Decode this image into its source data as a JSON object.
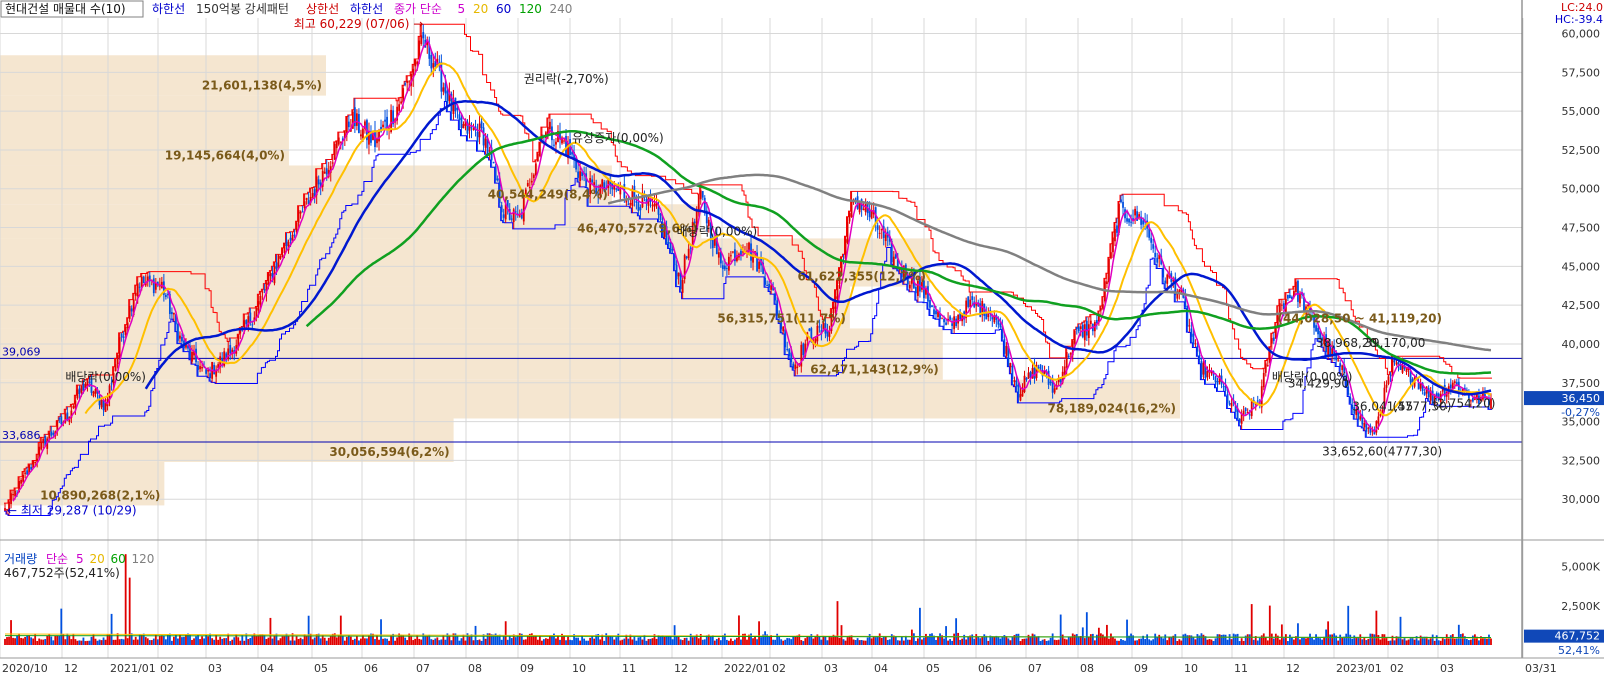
{
  "header": {
    "title_box": "현대건설 매물대 수(10)",
    "items": [
      {
        "text": "하한선",
        "color": "#0000cc"
      },
      {
        "text": "150억봉 강세패턴",
        "color": "#333333"
      },
      {
        "text": "상한선",
        "color": "#cc0000"
      },
      {
        "text": "하한선",
        "color": "#0000cc"
      },
      {
        "text": "종가 단순",
        "color": "#cc00cc"
      },
      {
        "text": "5",
        "color": "#cc00cc"
      },
      {
        "text": "20",
        "color": "#e6b800"
      },
      {
        "text": "60",
        "color": "#0000cc"
      },
      {
        "text": "120",
        "color": "#00a000"
      },
      {
        "text": "240",
        "color": "#808080"
      }
    ],
    "top_right_lc": "LC:24.0",
    "top_right_hc": "HC:-39.4"
  },
  "colors": {
    "up": "#e00000",
    "down": "#0050e0",
    "ma5": "#e000c0",
    "ma20": "#ffc000",
    "ma60": "#0018d0",
    "ma120": "#10a020",
    "ma240": "#808080",
    "band_upper": "#ff0000",
    "band_lower": "#0000ff",
    "volume_profile": "#f5e6d0",
    "hline": "#0000b0",
    "grid": "#d8d8d8"
  },
  "chart_data": [
    {
      "type": "candlestick",
      "title": "현대건설 매물대 수(10)",
      "ylim": [
        27500,
        61000
      ],
      "y_ticks": [
        "30,000",
        "32,500",
        "35,000",
        "37,500",
        "40,000",
        "42,500",
        "45,000",
        "47,500",
        "50,000",
        "52,500",
        "55,000",
        "57,500",
        "60,000"
      ],
      "x_ticks": [
        "2020/10",
        "12",
        "2021/01",
        "02",
        "03",
        "04",
        "05",
        "06",
        "07",
        "08",
        "09",
        "10",
        "11",
        "12",
        "2022/01",
        "02",
        "03",
        "04",
        "05",
        "06",
        "07",
        "08",
        "09",
        "10",
        "11",
        "12",
        "2023/01",
        "02",
        "03",
        "03/31"
      ],
      "close_anchors": [
        [
          0,
          29300
        ],
        [
          10,
          31500
        ],
        [
          20,
          33800
        ],
        [
          30,
          35200
        ],
        [
          40,
          37500
        ],
        [
          50,
          36000
        ],
        [
          58,
          40500
        ],
        [
          66,
          44000
        ],
        [
          78,
          43800
        ],
        [
          88,
          40000
        ],
        [
          100,
          38000
        ],
        [
          112,
          39500
        ],
        [
          124,
          42000
        ],
        [
          136,
          45500
        ],
        [
          148,
          48500
        ],
        [
          160,
          51500
        ],
        [
          172,
          54500
        ],
        [
          184,
          53000
        ],
        [
          196,
          55500
        ],
        [
          208,
          59500
        ],
        [
          214,
          58000
        ],
        [
          226,
          54000
        ],
        [
          238,
          53500
        ],
        [
          248,
          48500
        ],
        [
          256,
          48000
        ],
        [
          268,
          54000
        ],
        [
          278,
          53000
        ],
        [
          290,
          50000
        ],
        [
          302,
          50000
        ],
        [
          312,
          49500
        ],
        [
          324,
          48500
        ],
        [
          336,
          44000
        ],
        [
          346,
          49500
        ],
        [
          356,
          45000
        ],
        [
          368,
          46500
        ],
        [
          380,
          44000
        ],
        [
          392,
          38500
        ],
        [
          400,
          40500
        ],
        [
          410,
          41000
        ],
        [
          422,
          49500
        ],
        [
          432,
          48000
        ],
        [
          444,
          45000
        ],
        [
          456,
          43500
        ],
        [
          468,
          41000
        ],
        [
          480,
          42500
        ],
        [
          492,
          42000
        ],
        [
          504,
          37000
        ],
        [
          514,
          38500
        ],
        [
          522,
          37000
        ],
        [
          532,
          40500
        ],
        [
          544,
          41500
        ],
        [
          554,
          48500
        ],
        [
          566,
          48000
        ],
        [
          576,
          44500
        ],
        [
          584,
          43500
        ],
        [
          594,
          38500
        ],
        [
          604,
          37500
        ],
        [
          614,
          35000
        ],
        [
          624,
          36500
        ],
        [
          634,
          42500
        ],
        [
          642,
          43500
        ],
        [
          654,
          40500
        ],
        [
          664,
          38500
        ],
        [
          672,
          35500
        ],
        [
          680,
          34000
        ],
        [
          690,
          38500
        ],
        [
          700,
          38000
        ],
        [
          710,
          36500
        ],
        [
          720,
          37500
        ],
        [
          730,
          36500
        ],
        [
          738,
          36450
        ]
      ],
      "moving_averages": [
        {
          "name": "5",
          "period": 5
        },
        {
          "name": "20",
          "period": 20
        },
        {
          "name": "60",
          "period": 60
        },
        {
          "name": "120",
          "period": 120
        },
        {
          "name": "240",
          "period": 240
        }
      ],
      "volume_profile": [
        {
          "low": 56000,
          "high": 58600,
          "label": "21,601,138(4,5%)"
        },
        {
          "low": 51500,
          "high": 56000,
          "label": "19,145,664(4,0%)"
        },
        {
          "low": 49000,
          "high": 51500,
          "label": "40,544,249(8,4%)"
        },
        {
          "low": 46800,
          "high": 49000,
          "label": "46,470,572(9,6%)"
        },
        {
          "low": 43700,
          "high": 46800,
          "label": "61,622,355(12,7%)"
        },
        {
          "low": 41000,
          "high": 43700,
          "label": "56,315,751(11,7%)"
        },
        {
          "low": 37700,
          "high": 41000,
          "label": "62,471,143(12,9%)"
        },
        {
          "low": 35200,
          "high": 37700,
          "label": "78,189,024(16,2%)"
        },
        {
          "low": 32400,
          "high": 35200,
          "label": "30,056,594(6,2%)"
        },
        {
          "low": 29600,
          "high": 32400,
          "label": "10,890,268(2,1%)"
        }
      ],
      "profile_range_label": "(44,028,50 ~ 41,119,20)",
      "reference_lines": [
        {
          "value": 39069,
          "label": "39,069"
        },
        {
          "value": 33686,
          "label": "33,686"
        }
      ],
      "annotations": [
        {
          "text": "최고 60,229 (07/06)",
          "x": 210,
          "y": 60229
        },
        {
          "text": "최저 29,287 (10/29)",
          "x": 0,
          "y": 29287
        },
        {
          "text": "권리락(-2,70%)",
          "x": 258,
          "y": 56800
        },
        {
          "text": "유상증자(0,00%)",
          "x": 282,
          "y": 53000
        },
        {
          "text": "배당락(0,00%)",
          "x": 334,
          "y": 47000
        },
        {
          "text": "배당락(0,00%)",
          "x": 30,
          "y": 37600
        },
        {
          "text": "배당락(0,00%)",
          "x": 630,
          "y": 37600
        },
        {
          "text": "38,968,20",
          "x": 652,
          "y": 39800
        },
        {
          "text": "39,170,00",
          "x": 676,
          "y": 39800
        },
        {
          "text": "34,429,90",
          "x": 638,
          "y": 37200
        },
        {
          "text": "36,041,55",
          "x": 670,
          "y": 35700
        },
        {
          "text": "(4777,30)",
          "x": 690,
          "y": 35700
        },
        {
          "text": "(2,754,20)",
          "x": 710,
          "y": 35900
        },
        {
          "text": "33,652,60(4777,30)",
          "x": 655,
          "y": 32800
        }
      ],
      "current_price": "36,450",
      "current_change": "-0,27%"
    },
    {
      "type": "bar",
      "title": "거래량",
      "legend": [
        {
          "text": "거래량",
          "color": "#0040c0"
        },
        {
          "text": "단순",
          "color": "#cc00cc"
        },
        {
          "text": "5",
          "color": "#cc00cc"
        },
        {
          "text": "20",
          "color": "#e6b800"
        },
        {
          "text": "60",
          "color": "#00a000"
        },
        {
          "text": "120",
          "color": "#808080"
        }
      ],
      "info": "467,752주(52,41%)",
      "ylim": [
        0,
        6000
      ],
      "y_ticks": [
        "2,500K",
        "5,000K"
      ],
      "current_value": "467,752",
      "current_pct": "52,41%"
    }
  ]
}
